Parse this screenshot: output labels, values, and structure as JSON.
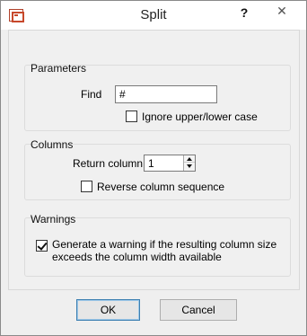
{
  "window": {
    "title": "Split",
    "help_label": "?",
    "close_label": "✕"
  },
  "parameters": {
    "group_label": "Parameters",
    "find_label": "Find",
    "find_value": "#",
    "ignore_case_label": "Ignore upper/lower case",
    "ignore_case_checked": false
  },
  "columns": {
    "group_label": "Columns",
    "return_column_label": "Return column",
    "return_column_value": "1",
    "reverse_label": "Reverse column sequence",
    "reverse_checked": false
  },
  "warnings": {
    "group_label": "Warnings",
    "warning_label_line1": "Generate a warning if the resulting column size",
    "warning_label_line2": "exceeds the column width available",
    "warning_checked": true
  },
  "buttons": {
    "ok_label": "OK",
    "cancel_label": "Cancel"
  }
}
